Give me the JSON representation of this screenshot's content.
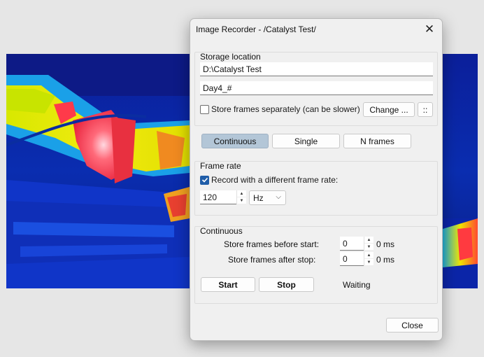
{
  "window": {
    "title": "Image Recorder - /Catalyst Test/",
    "close_icon": "close-icon"
  },
  "storage": {
    "group_title": "Storage location",
    "path_value": "D:\\Catalyst Test",
    "name_value": "Day4_#",
    "separate_label": "Store frames separately (can be slower)",
    "separate_checked": false,
    "change_label": "Change ...",
    "more_label": "::"
  },
  "modes": {
    "items": [
      "Continuous",
      "Single",
      "N frames"
    ],
    "selected": "Continuous"
  },
  "frame_rate": {
    "group_title": "Frame rate",
    "different_label": "Record with a different frame rate:",
    "different_checked": true,
    "rate_value": "120",
    "unit_value": "Hz"
  },
  "continuous": {
    "group_title": "Continuous",
    "before_label": "Store frames before start:",
    "before_value": "0",
    "before_unit": "0 ms",
    "after_label": "Store frames after stop:",
    "after_value": "0",
    "after_unit": "0 ms",
    "start_label": "Start",
    "stop_label": "Stop",
    "status": "Waiting"
  },
  "footer": {
    "close_label": "Close"
  },
  "colors": {
    "accent": "#1f5da8",
    "selected_mode_bg": "#b3c6d7",
    "dialog_bg": "#f0f0f0",
    "thermal_cold": "#0a1a8c",
    "thermal_hot": "#ffe800",
    "thermal_peak": "#e8203a"
  }
}
